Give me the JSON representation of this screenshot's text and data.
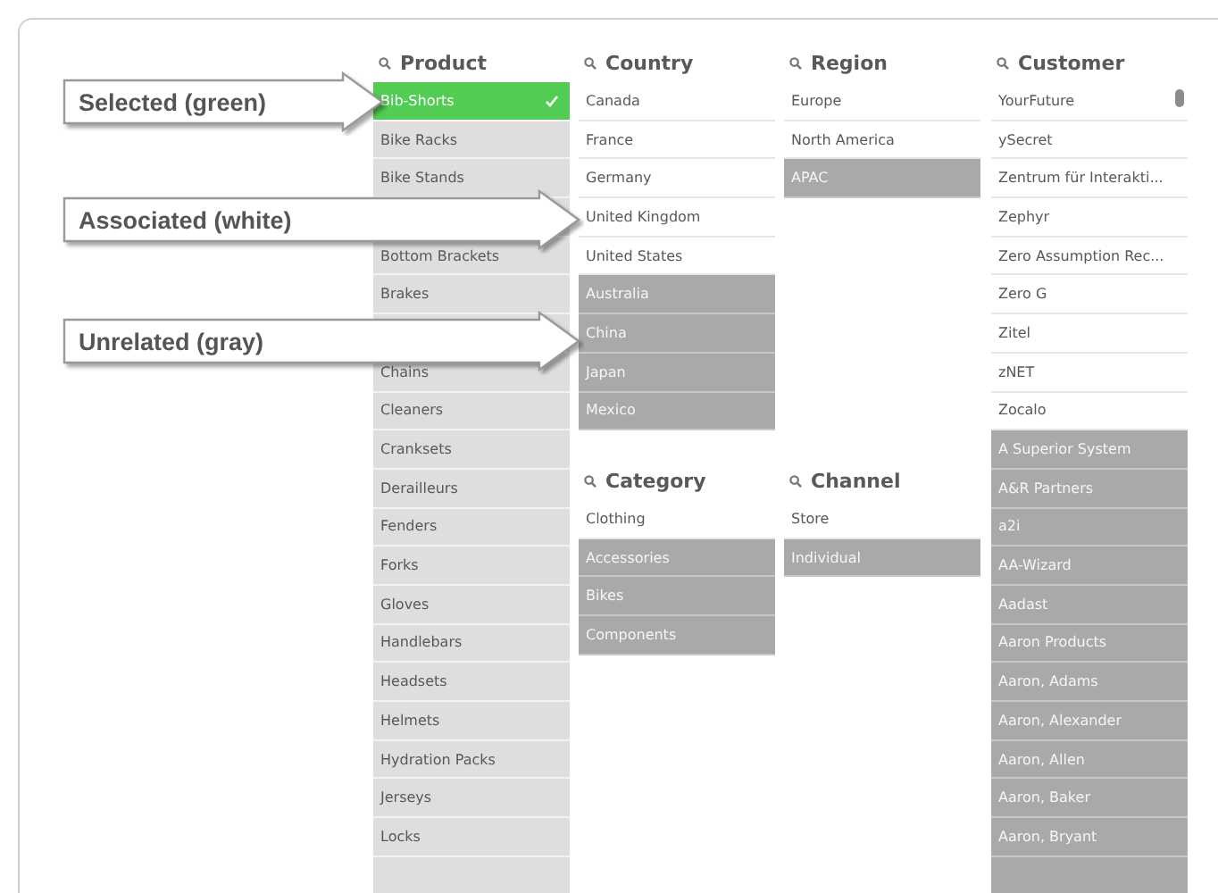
{
  "callouts": [
    {
      "label": "Selected (green)"
    },
    {
      "label": "Associated (white)"
    },
    {
      "label": "Unrelated (gray)"
    }
  ],
  "filters": [
    {
      "title": "Product",
      "scrollbar": false,
      "items": [
        {
          "label": "Bib-Shorts",
          "kind": "possible",
          "selected": true
        },
        {
          "label": "Bike Racks",
          "kind": "alternative",
          "selected": false
        },
        {
          "label": "Bike Stands",
          "kind": "alternative",
          "selected": false
        },
        {
          "kind": "alternative",
          "selected": false
        },
        {
          "label": "Bottom Brackets",
          "kind": "alternative",
          "selected": false
        },
        {
          "label": "Brakes",
          "kind": "alternative",
          "selected": false
        },
        {
          "kind": "alternative",
          "selected": false
        },
        {
          "label": "Chains",
          "kind": "alternative",
          "selected": false
        },
        {
          "label": "Cleaners",
          "kind": "alternative",
          "selected": false
        },
        {
          "label": "Cranksets",
          "kind": "alternative",
          "selected": false
        },
        {
          "label": "Derailleurs",
          "kind": "alternative",
          "selected": false
        },
        {
          "label": "Fenders",
          "kind": "alternative",
          "selected": false
        },
        {
          "label": "Forks",
          "kind": "alternative",
          "selected": false
        },
        {
          "label": "Gloves",
          "kind": "alternative",
          "selected": false
        },
        {
          "label": "Handlebars",
          "kind": "alternative",
          "selected": false
        },
        {
          "label": "Headsets",
          "kind": "alternative",
          "selected": false
        },
        {
          "label": "Helmets",
          "kind": "alternative",
          "selected": false
        },
        {
          "label": "Hydration Packs",
          "kind": "alternative",
          "selected": false
        },
        {
          "label": "Jerseys",
          "kind": "alternative",
          "selected": false
        },
        {
          "label": "Locks",
          "kind": "alternative",
          "selected": false
        },
        {
          "kind": "alternative",
          "selected": false
        }
      ]
    },
    {
      "title": "Country",
      "scrollbar": false,
      "items": [
        {
          "label": "Canada",
          "kind": "possible",
          "selected": false
        },
        {
          "label": "France",
          "kind": "possible",
          "selected": false
        },
        {
          "label": "Germany",
          "kind": "possible",
          "selected": false
        },
        {
          "label": "United Kingdom",
          "kind": "possible",
          "selected": false
        },
        {
          "label": "United States",
          "kind": "possible",
          "selected": false
        },
        {
          "label": "Australia",
          "kind": "excluded",
          "selected": false
        },
        {
          "label": "China",
          "kind": "excluded",
          "selected": false
        },
        {
          "label": "Japan",
          "kind": "excluded",
          "selected": false
        },
        {
          "label": "Mexico",
          "kind": "excluded",
          "selected": false
        }
      ]
    },
    {
      "title": "Category",
      "scrollbar": false,
      "items": [
        {
          "label": "Clothing",
          "kind": "possible",
          "selected": false
        },
        {
          "label": "Accessories",
          "kind": "excluded",
          "selected": false
        },
        {
          "label": "Bikes",
          "kind": "excluded",
          "selected": false
        },
        {
          "label": "Components",
          "kind": "excluded",
          "selected": false
        }
      ]
    },
    {
      "title": "Region",
      "scrollbar": false,
      "items": [
        {
          "label": "Europe",
          "kind": "possible",
          "selected": false
        },
        {
          "label": "North America",
          "kind": "possible",
          "selected": false
        },
        {
          "label": "APAC",
          "kind": "excluded",
          "selected": false
        }
      ]
    },
    {
      "title": "Channel",
      "scrollbar": false,
      "items": [
        {
          "label": "Store",
          "kind": "possible",
          "selected": false
        },
        {
          "label": "Individual",
          "kind": "excluded",
          "selected": false
        }
      ]
    },
    {
      "title": "Customer",
      "scrollbar": true,
      "items": [
        {
          "label": "YourFuture",
          "kind": "possible",
          "selected": false
        },
        {
          "label": "ySecret",
          "kind": "possible",
          "selected": false
        },
        {
          "label": "Zentrum für Interakti...",
          "kind": "possible",
          "selected": false
        },
        {
          "label": "Zephyr",
          "kind": "possible",
          "selected": false
        },
        {
          "label": "Zero Assumption Rec...",
          "kind": "possible",
          "selected": false
        },
        {
          "label": "Zero G",
          "kind": "possible",
          "selected": false
        },
        {
          "label": "Zitel",
          "kind": "possible",
          "selected": false
        },
        {
          "label": "zNET",
          "kind": "possible",
          "selected": false
        },
        {
          "label": "Zocalo",
          "kind": "possible",
          "selected": false
        },
        {
          "label": "A Superior System",
          "kind": "excluded",
          "selected": false
        },
        {
          "label": "A&R Partners",
          "kind": "excluded",
          "selected": false
        },
        {
          "label": "a2i",
          "kind": "excluded",
          "selected": false
        },
        {
          "label": "AA-Wizard",
          "kind": "excluded",
          "selected": false
        },
        {
          "label": "Aadast",
          "kind": "excluded",
          "selected": false
        },
        {
          "label": "Aaron Products",
          "kind": "excluded",
          "selected": false
        },
        {
          "label": "Aaron, Adams",
          "kind": "excluded",
          "selected": false
        },
        {
          "label": "Aaron, Alexander",
          "kind": "excluded",
          "selected": false
        },
        {
          "label": "Aaron, Allen",
          "kind": "excluded",
          "selected": false
        },
        {
          "label": "Aaron, Baker",
          "kind": "excluded",
          "selected": false
        },
        {
          "label": "Aaron, Bryant",
          "kind": "excluded",
          "selected": false
        },
        {
          "kind": "excluded",
          "selected": false
        }
      ]
    }
  ]
}
